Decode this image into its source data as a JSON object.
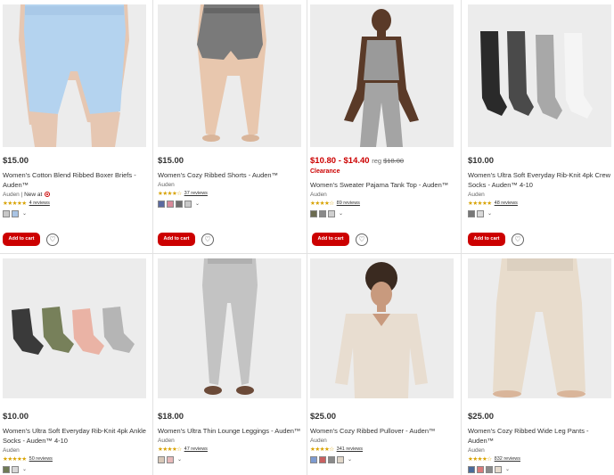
{
  "products": [
    {
      "price": "$15.00",
      "title": "Women's Cotton Blend Ribbed Boxer Briefs - Auden™",
      "brand": "Auden",
      "new_at": "New at",
      "stars": "★★★★★",
      "reviews": "4 reviews",
      "swatches": [
        "#c8c8c8",
        "#a9c4e4"
      ],
      "add_to_cart": "Add to cart",
      "image": "light-blue-boxer-briefs"
    },
    {
      "price": "$15.00",
      "title": "Women's Cozy Ribbed Shorts - Auden™",
      "brand": "Auden",
      "stars": "★★★★☆",
      "reviews": "37 reviews",
      "swatches": [
        "#5a6aa0",
        "#d98a9a",
        "#6e6e6e",
        "#c9c9c9"
      ],
      "add_to_cart": "Add to cart",
      "image": "gray-ribbed-shorts"
    },
    {
      "price_sale": "$10.80 - $14.40",
      "price_reg_label": "reg",
      "price_reg": "$18.00",
      "clearance": "Clearance",
      "title": "Women's Sweater Pajama Tank Top - Auden™",
      "brand": "Auden",
      "stars": "★★★★☆",
      "reviews": "89 reviews",
      "swatches": [
        "#6b6b50",
        "#8a8a8a",
        "#cfcfcf"
      ],
      "add_to_cart": "Add to cart",
      "image": "gray-pajama-tank-top"
    },
    {
      "price": "$10.00",
      "title": "Women's Ultra Soft Everyday Rib-Knit 4pk Crew Socks - Auden™ 4-10",
      "brand": "Auden",
      "stars": "★★★★★",
      "reviews": "48 reviews",
      "swatches": [
        "#777777",
        "#d9d9d9"
      ],
      "add_to_cart": "Add to cart",
      "image": "crew-socks-4pk"
    },
    {
      "price": "$10.00",
      "title": "Women's Ultra Soft Everyday Rib-Knit 4pk Ankle Socks - Auden™ 4-10",
      "brand": "Auden",
      "stars": "★★★★★",
      "reviews": "50 reviews",
      "swatches": [
        "#6f7a55",
        "#d8d8d8"
      ],
      "image": "ankle-socks-4pk"
    },
    {
      "price": "$18.00",
      "title": "Women's Ultra Thin Lounge Leggings - Auden™",
      "brand": "Auden",
      "stars": "★★★★☆",
      "reviews": "47 reviews",
      "swatches": [
        "#d8c8b8",
        "#e7b9b9"
      ],
      "image": "gray-lounge-leggings"
    },
    {
      "price": "$25.00",
      "title": "Women's Cozy Ribbed Pullover - Auden™",
      "brand": "Auden",
      "stars": "★★★★☆",
      "reviews": "341 reviews",
      "swatches": [
        "#7d9bd0",
        "#c96060",
        "#8a8a8a",
        "#e0d6c8"
      ],
      "image": "beige-ribbed-pullover"
    },
    {
      "price": "$25.00",
      "title": "Women's Cozy Ribbed Wide Leg Pants - Auden™",
      "brand": "Auden",
      "stars": "★★★★☆",
      "reviews": "832 reviews",
      "swatches": [
        "#4a6a9a",
        "#d97a7a",
        "#8a8a8a",
        "#e6dccf"
      ],
      "image": "beige-wide-leg-pants"
    }
  ],
  "colors": {
    "accent": "#cc0000",
    "star": "#d8a200"
  },
  "icons": {
    "wishlist": "heart-icon",
    "swatch_more": "chevron-down-icon",
    "brand_badge": "target-bullseye-icon"
  }
}
